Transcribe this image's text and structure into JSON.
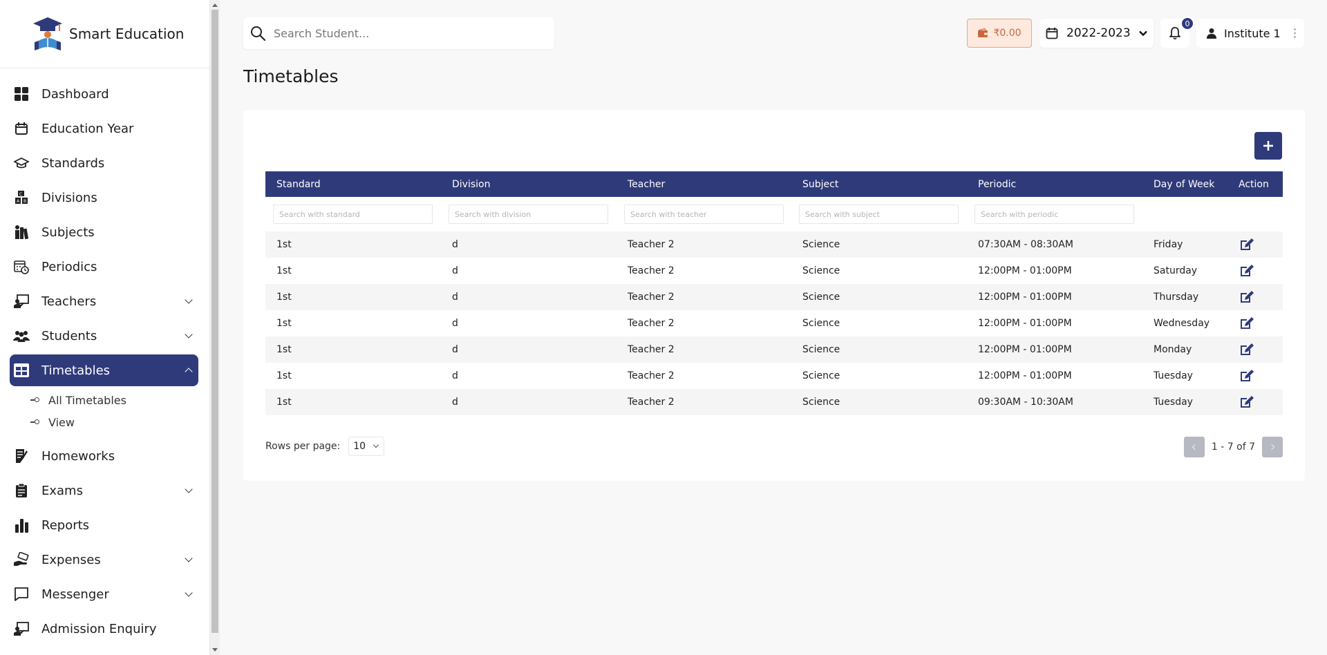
{
  "brand": {
    "name": "Smart Education"
  },
  "sidebar": {
    "items": [
      {
        "label": "Dashboard",
        "icon": "dashboard-icon"
      },
      {
        "label": "Education Year",
        "icon": "calendar-icon"
      },
      {
        "label": "Standards",
        "icon": "graduation-cap-icon"
      },
      {
        "label": "Divisions",
        "icon": "alphabet-blocks-icon"
      },
      {
        "label": "Subjects",
        "icon": "books-icon"
      },
      {
        "label": "Periodics",
        "icon": "calendar-clock-icon"
      },
      {
        "label": "Teachers",
        "icon": "teacher-board-icon"
      },
      {
        "label": "Students",
        "icon": "users-group-icon"
      },
      {
        "label": "Timetables",
        "icon": "table-icon"
      },
      {
        "label": "Homeworks",
        "icon": "homework-icon"
      },
      {
        "label": "Exams",
        "icon": "clipboard-icon"
      },
      {
        "label": "Reports",
        "icon": "bar-chart-icon"
      },
      {
        "label": "Expenses",
        "icon": "hand-money-icon"
      },
      {
        "label": "Messenger",
        "icon": "message-icon"
      },
      {
        "label": "Admission Enquiry",
        "icon": "enquiry-icon"
      }
    ],
    "timetables_sub": [
      "All Timetables",
      "View"
    ]
  },
  "topbar": {
    "search_placeholder": "Search Student...",
    "wallet_amount": "₹0.00",
    "year": "2022-2023",
    "notification_count": "0",
    "user_name": "Institute 1"
  },
  "page": {
    "title": "Timetables"
  },
  "table": {
    "headers": [
      "Standard",
      "Division",
      "Teacher",
      "Subject",
      "Periodic",
      "Day of Week",
      "Action"
    ],
    "filters": [
      "Search with standard",
      "Search with division",
      "Search with teacher",
      "Search with subject",
      "Search with periodic"
    ],
    "rows": [
      [
        "1st",
        "d",
        "Teacher 2",
        "Science",
        "07:30AM - 08:30AM",
        "Friday"
      ],
      [
        "1st",
        "d",
        "Teacher 2",
        "Science",
        "12:00PM - 01:00PM",
        "Saturday"
      ],
      [
        "1st",
        "d",
        "Teacher 2",
        "Science",
        "12:00PM - 01:00PM",
        "Thursday"
      ],
      [
        "1st",
        "d",
        "Teacher 2",
        "Science",
        "12:00PM - 01:00PM",
        "Wednesday"
      ],
      [
        "1st",
        "d",
        "Teacher 2",
        "Science",
        "12:00PM - 01:00PM",
        "Monday"
      ],
      [
        "1st",
        "d",
        "Teacher 2",
        "Science",
        "12:00PM - 01:00PM",
        "Tuesday"
      ],
      [
        "1st",
        "d",
        "Teacher 2",
        "Science",
        "09:30AM - 10:30AM",
        "Tuesday"
      ]
    ]
  },
  "pagination": {
    "rows_label": "Rows per page:",
    "rows_value": "10",
    "range": "1 - 7 of 7"
  },
  "colors": {
    "primary": "#2f3a7a",
    "wallet_bg": "#fde9de",
    "wallet_text": "#c9673f"
  }
}
